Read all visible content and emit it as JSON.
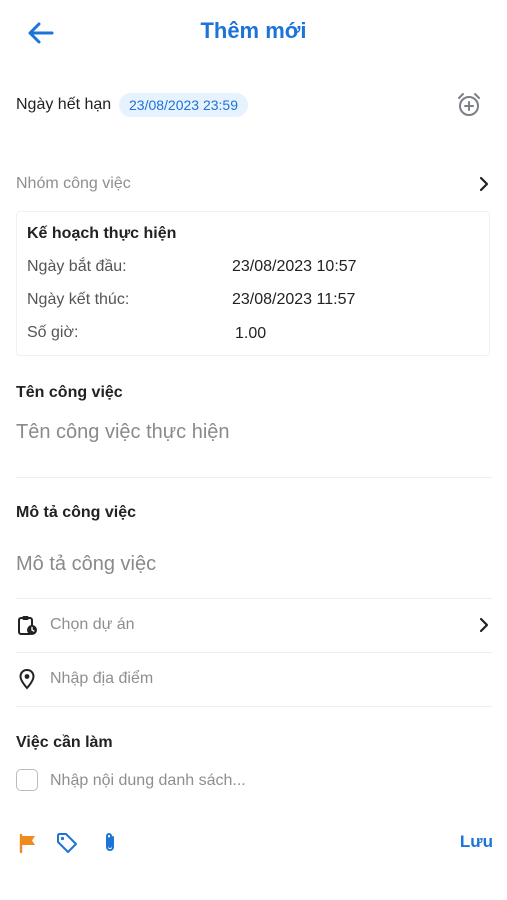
{
  "header": {
    "title": "Thêm mới",
    "back_icon": "arrow-left-icon"
  },
  "deadline": {
    "label": "Ngày hết hạn",
    "value": "23/08/2023 23:59",
    "alarm_icon": "alarm-add-icon"
  },
  "group": {
    "placeholder": "Nhóm công việc"
  },
  "plan": {
    "title": "Kế hoạch thực hiện",
    "start_label": "Ngày bắt đầu:",
    "start_value": "23/08/2023 10:57",
    "end_label": "Ngày kết thúc:",
    "end_value": "23/08/2023 11:57",
    "hours_label": "Số giờ:",
    "hours_value": "1.00"
  },
  "task_name": {
    "title": "Tên công việc",
    "placeholder": "Tên công việc thực hiện"
  },
  "description": {
    "title": "Mô tả công việc",
    "placeholder": "Mô tả công việc"
  },
  "project": {
    "placeholder": "Chọn dự án"
  },
  "location": {
    "placeholder": "Nhập địa điểm"
  },
  "todo": {
    "title": "Việc cần làm",
    "placeholder": "Nhập nội dung danh sách..."
  },
  "toolbar": {
    "save_label": "Lưu"
  },
  "colors": {
    "accent": "#1e73d9",
    "flag": "#f08a1c",
    "chip_bg": "#e6f2fd"
  }
}
